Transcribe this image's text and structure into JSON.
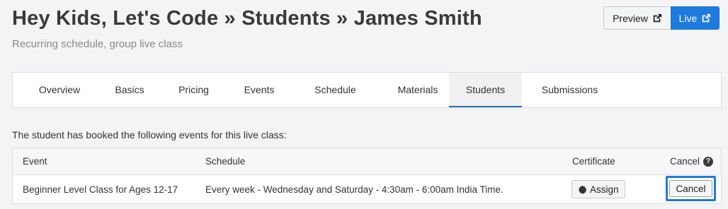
{
  "header": {
    "title": "Hey Kids, Let's Code » Students » James Smith",
    "subtitle": "Recurring schedule, group live class",
    "preview_label": "Preview",
    "live_label": "Live"
  },
  "tabs": [
    {
      "label": "Overview",
      "active": false
    },
    {
      "label": "Basics",
      "active": false
    },
    {
      "label": "Pricing",
      "active": false
    },
    {
      "label": "Events",
      "active": false
    },
    {
      "label": "Schedule",
      "active": false
    },
    {
      "label": "Materials",
      "active": false
    },
    {
      "label": "Students",
      "active": true
    },
    {
      "label": "Submissions",
      "active": false
    }
  ],
  "intro_text": "The student has booked the following events for this live class:",
  "table": {
    "headers": {
      "event": "Event",
      "schedule": "Schedule",
      "certificate": "Certificate",
      "cancel": "Cancel"
    },
    "rows": [
      {
        "event": "Beginner Level Class for Ages 12-17",
        "schedule": "Every week - Wednesday and Saturday - 4:30am - 6:00am India Time.",
        "assign_label": "Assign",
        "cancel_label": "Cancel"
      }
    ]
  },
  "icons": {
    "preview": "external-link-icon",
    "live": "external-link-icon",
    "help": "question-circle-icon",
    "assign": "certificate-badge-icon"
  },
  "colors": {
    "accent": "#1f7ae0",
    "tab_underline": "#2a6fba",
    "background": "#f4f4f7"
  }
}
